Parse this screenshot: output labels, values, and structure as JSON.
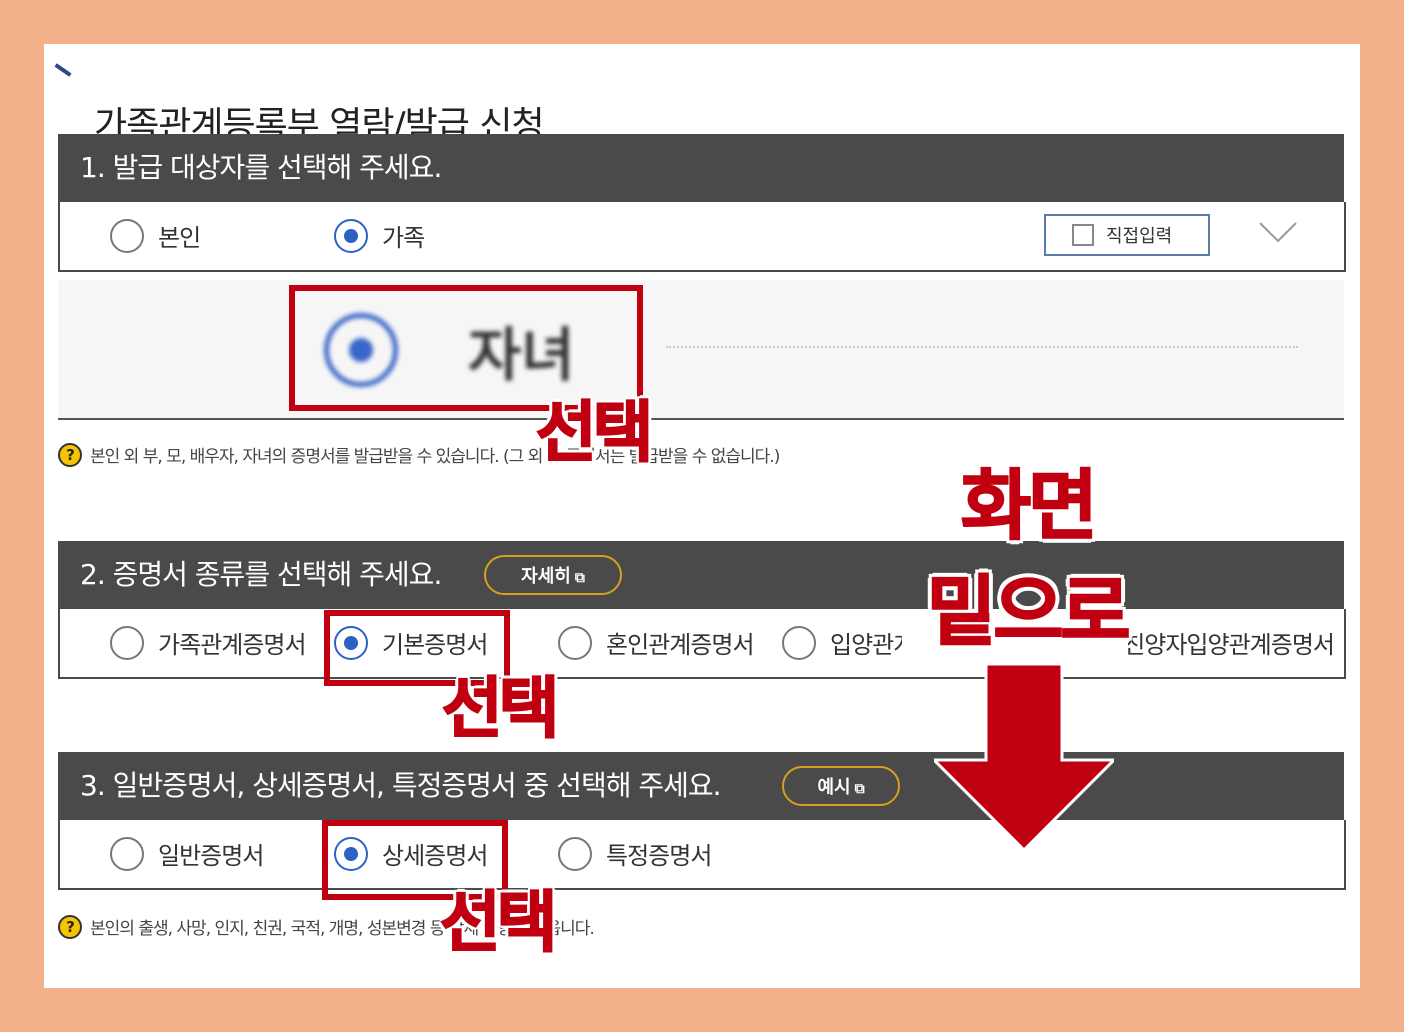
{
  "page": {
    "title": "가족관계등록부 열람/발급 신청"
  },
  "section1": {
    "heading": "1. 발급 대상자를 선택해 주세요.",
    "options": [
      {
        "label": "본인",
        "selected": false
      },
      {
        "label": "가족",
        "selected": true
      }
    ],
    "direct_input_label": "직접입력",
    "child_option": {
      "label": "자녀",
      "selected": true
    },
    "note": "본인 외 부, 모, 배우자, 자녀의 증명서를 발급받을 수 있습니다. (그 외 의 증명서는 발급받을 수 없습니다.)"
  },
  "section2": {
    "heading": "2. 증명서 종류를 선택해 주세요.",
    "detail_button": "자세히",
    "options": [
      {
        "label": "가족관계증명서",
        "selected": false
      },
      {
        "label": "기본증명서",
        "selected": true
      },
      {
        "label": "혼인관계증명서",
        "selected": false
      },
      {
        "label": "입양관계증명서",
        "selected": false
      },
      {
        "label": "친양자입양관계증명서",
        "selected": false
      }
    ]
  },
  "section3": {
    "heading": "3. 일반증명서, 상세증명서, 특정증명서 중 선택해 주세요.",
    "example_button": "예시",
    "options": [
      {
        "label": "일반증명서",
        "selected": false
      },
      {
        "label": "상세증명서",
        "selected": true
      },
      {
        "label": "특정증명서",
        "selected": false
      }
    ],
    "note": "본인의 출생, 사망, 인지, 친권, 국적, 개명, 성본변경 등 상세 사항이 나옵니다."
  },
  "annotations": {
    "select_1": "선택",
    "select_2": "선택",
    "select_3": "선택",
    "scroll_line1": "화면",
    "scroll_line2": "밑으로",
    "accent_color": "#c00010",
    "frame_color": "#f2b188"
  }
}
